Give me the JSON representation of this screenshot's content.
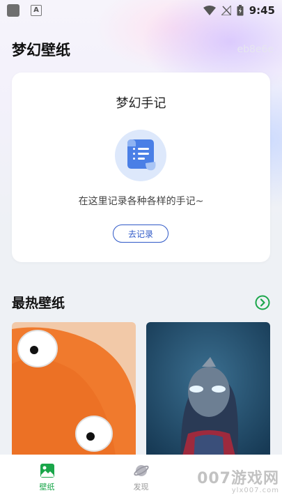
{
  "status_bar": {
    "time": "9:45",
    "icons": [
      "notification-square-icon",
      "keyboard-a-icon",
      "wifi-icon",
      "no-signal-icon",
      "battery-charging-icon"
    ]
  },
  "header": {
    "title": "梦幻壁纸",
    "faded_code": "eb8e6e"
  },
  "note_card": {
    "title": "梦幻手记",
    "icon": "scroll-note-icon",
    "description": "在这里记录各种各样的手记~",
    "button_label": "去记录"
  },
  "hot_section": {
    "title": "最热壁纸",
    "more_icon": "arrow-right-circle-icon",
    "accent_color": "#1aa64a",
    "thumbnails": [
      {
        "subject": "orange plush toy with googly eyes"
      },
      {
        "subject": "ultraman figure"
      }
    ]
  },
  "bottom_nav": {
    "items": [
      {
        "label": "壁纸",
        "icon": "wallpaper-icon",
        "active": true
      },
      {
        "label": "发现",
        "icon": "discover-planet-icon",
        "active": false
      }
    ]
  },
  "watermark": {
    "main": "007游戏网",
    "sub": "ylx007.com"
  },
  "colors": {
    "accent_green": "#1aa64a",
    "button_blue": "#2e58c7"
  }
}
